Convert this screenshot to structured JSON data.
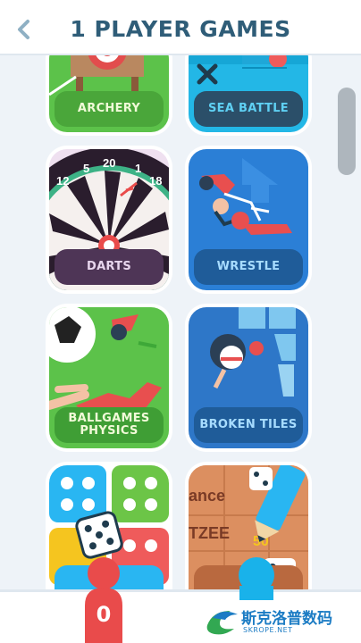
{
  "header": {
    "title": "1 PLAYER GAMES",
    "back_icon": "chevron-left-icon"
  },
  "games": [
    {
      "label": "ARCHERY"
    },
    {
      "label": "SEA BATTLE"
    },
    {
      "label": "DARTS"
    },
    {
      "label": "WRESTLE"
    },
    {
      "label": "BALLGAMES PHYSICS"
    },
    {
      "label": "BROKEN TILES"
    },
    {
      "label": ""
    },
    {
      "label": ""
    }
  ],
  "darts_numbers": [
    "12",
    "5",
    "20",
    "1",
    "18"
  ],
  "dice_game_texts": {
    "word1": "ance",
    "word2": "TZEE",
    "number": "50"
  },
  "bottom_bar": {
    "player_red_score": "0",
    "player_blue_score": ""
  },
  "watermark": {
    "text": "斯克洛普数码",
    "sub": "SKROPE.NET"
  },
  "colors": {
    "title": "#2f5d78",
    "accent_red": "#e94b4b",
    "accent_blue": "#19b2ea"
  }
}
